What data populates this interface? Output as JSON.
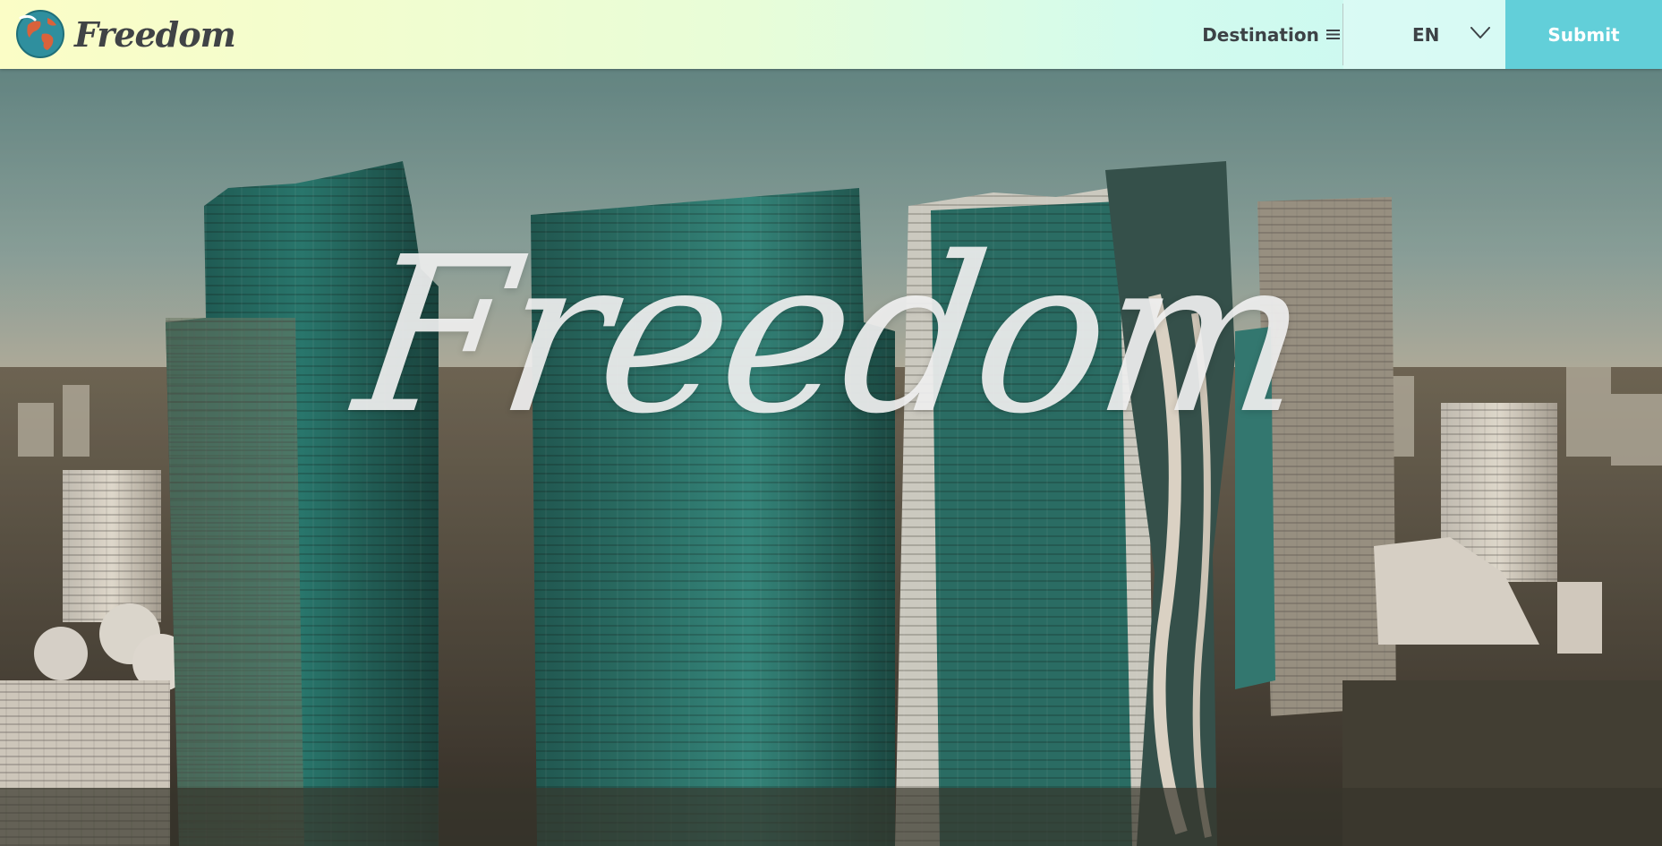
{
  "header": {
    "logo": {
      "text": "Freedom",
      "icon": "globe-icon"
    },
    "nav": {
      "destination_label": "Destination",
      "destination_icon": "menu-icon"
    },
    "language": {
      "selected": "EN",
      "icon": "chevron-down-icon"
    },
    "submit_label": "Submit"
  },
  "hero": {
    "title": "Freedom",
    "background": "aerial city skyline with teal glass skyscrapers"
  },
  "colors": {
    "header_gradient_start": "#fbfdc6",
    "header_gradient_end": "#c6f6f3",
    "submit_button": "#62cfd9",
    "nav_text": "#3d4246",
    "hero_title": "#f0f0f0"
  }
}
